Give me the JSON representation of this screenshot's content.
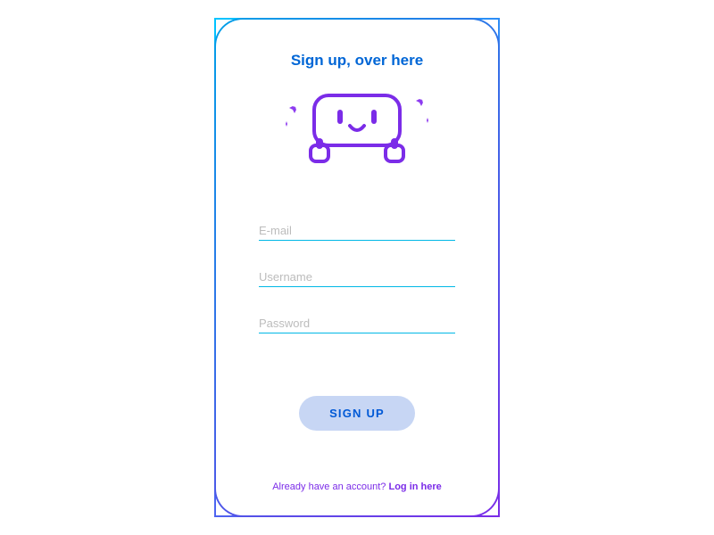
{
  "header": {
    "title": "Sign up, over here"
  },
  "form": {
    "email_placeholder": "E-mail",
    "username_placeholder": "Username",
    "password_placeholder": "Password",
    "submit_label": "SIGN UP"
  },
  "footer": {
    "prompt": "Already have an account? ",
    "link_text": "Log in here"
  },
  "colors": {
    "accent_blue": "#0066d6",
    "gradient_start": "#00a0e8",
    "gradient_end": "#7b2ce8",
    "input_underline": "#00b8e6",
    "button_bg": "#c7d6f4"
  }
}
